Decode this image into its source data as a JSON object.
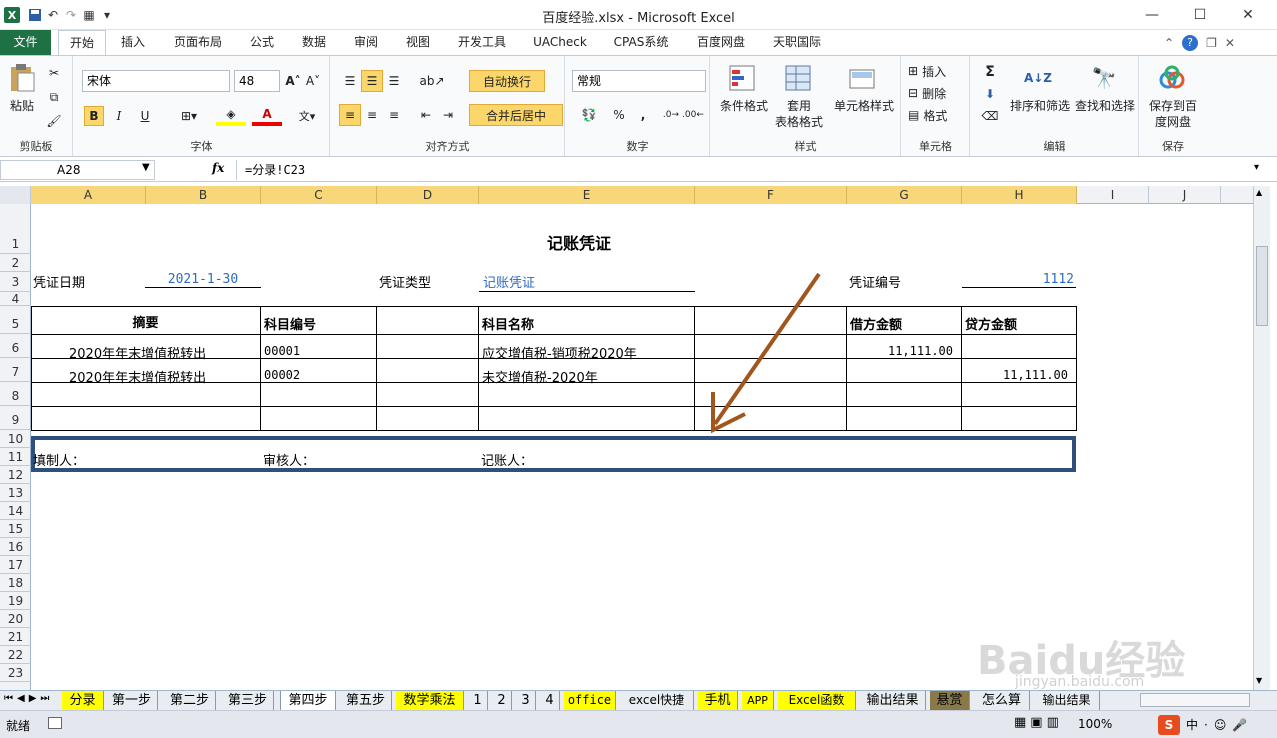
{
  "window": {
    "title": "百度经验.xlsx - Microsoft Excel",
    "minimize": "—",
    "maximize": "☐",
    "close": "✕"
  },
  "quick_access": {
    "logo": "X"
  },
  "tabs": [
    "文件",
    "开始",
    "插入",
    "页面布局",
    "公式",
    "数据",
    "审阅",
    "视图",
    "开发工具",
    "UACheck",
    "CPAS系统",
    "百度网盘",
    "天职国际"
  ],
  "ribbon": {
    "clipboard": {
      "paste": "粘贴",
      "group": "剪贴板"
    },
    "font": {
      "name": "宋体",
      "size": "48",
      "group": "字体",
      "bold": "B",
      "italic": "I",
      "underline": "U"
    },
    "align": {
      "wrap": "自动换行",
      "merge": "合并后居中",
      "group": "对齐方式"
    },
    "number": {
      "format": "常规",
      "percent": "%",
      "comma": ",",
      "group": "数字"
    },
    "styles": {
      "cond": "条件格式",
      "table_1": "套用",
      "table_2": "表格格式",
      "cell": "单元格样式",
      "group": "样式"
    },
    "cells": {
      "insert": "插入",
      "delete": "删除",
      "format": "格式",
      "group": "单元格"
    },
    "edit": {
      "sigma": "Σ",
      "sort": "排序和筛选",
      "find": "查找和选择",
      "group": "编辑"
    },
    "save": {
      "label_1": "保存到百",
      "label_2": "度网盘",
      "group": "保存"
    }
  },
  "formula_bar": {
    "name_box": "A28",
    "fx": "fx",
    "formula": "=分录!C23"
  },
  "columns": [
    "A",
    "B",
    "C",
    "D",
    "E",
    "F",
    "G",
    "H",
    "I",
    "J"
  ],
  "rows": [
    "1",
    "2",
    "3",
    "4",
    "5",
    "6",
    "7",
    "8",
    "9",
    "10",
    "11",
    "12",
    "13",
    "14",
    "15",
    "16",
    "17",
    "18",
    "19",
    "20",
    "21",
    "22",
    "23"
  ],
  "sheet": {
    "title": "记账凭证",
    "date_label": "凭证日期",
    "date_value": "2021-1-30",
    "type_label": "凭证类型",
    "type_value": "记账凭证",
    "num_label": "凭证编号",
    "num_value": "1112",
    "headers": {
      "summary": "摘要",
      "code": "科目编号",
      "name": "科目名称",
      "debit": "借方金额",
      "credit": "贷方金额"
    },
    "entries": [
      {
        "summary": "2020年年末增值税转出",
        "code": "00001",
        "name": "应交增值税-销项税2020年",
        "debit": "11,111.00",
        "credit": ""
      },
      {
        "summary": "2020年年末增值税转出",
        "code": "00002",
        "name": "未交增值税-2020年",
        "debit": "",
        "credit": "11,111.00"
      }
    ],
    "maker": "填制人：",
    "reviewer": "审核人：",
    "bookkeeper": "记账人："
  },
  "sheet_tabs": [
    "分录",
    "第一步",
    "第二步",
    "第三步",
    "第四步",
    "第五步",
    "数学乘法",
    "1",
    "2",
    "3",
    "4",
    "office",
    "excel快捷",
    "手机",
    "APP",
    "Excel函数",
    "输出结果",
    "悬赏",
    "怎么算",
    "输出结果"
  ],
  "status": {
    "ready": "就绪",
    "zoom": "100%"
  },
  "watermark": {
    "brand": "Baidu经验",
    "url": "jingyan.baidu.com"
  },
  "colors": {
    "excel_green": "#1e7145",
    "highlight": "#fbd66a",
    "arrow": "#a0561c",
    "box_border": "#2f4f7f",
    "blue_text": "#2e6bc4"
  }
}
